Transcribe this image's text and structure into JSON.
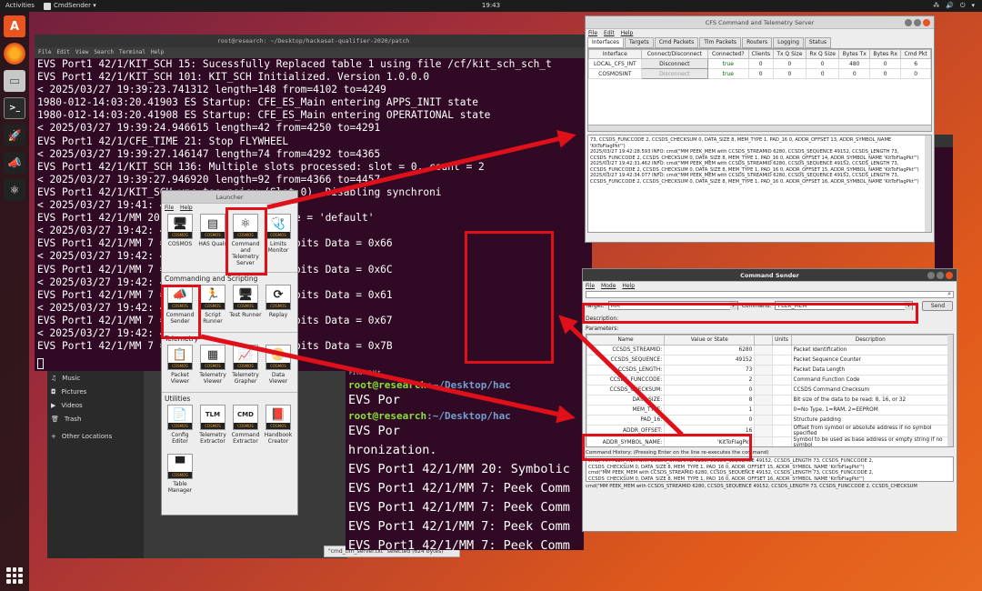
{
  "topbar": {
    "activities": "Activities",
    "app": "CmdSender ▾",
    "clock": "19:43",
    "tray": [
      "⁂",
      "🔊",
      "⏻",
      "▾"
    ]
  },
  "dock": {
    "icons": [
      "software-icon",
      "firefox-icon",
      "files-icon",
      "terminal-icon",
      "cosmos-rocket-icon",
      "cmd-sender-icon",
      "cts-icon"
    ]
  },
  "terminal1": {
    "title": "root@research: ~/Desktop/hackasat-qualifier-2020/patch",
    "menu": [
      "File",
      "Edit",
      "View",
      "Search",
      "Terminal",
      "Help"
    ],
    "lines": [
      "EVS Port1 42/1/KIT_SCH 15: Sucessfully Replaced table 1 using file /cf/kit_sch_sch_t",
      "EVS Port1 42/1/KIT_SCH 101: KIT_SCH Initialized. Version 1.0.0.0",
      "< 2025/03/27 19:39:23.741312  length=148 from=4102 to=4249",
      "1980-012-14:03:20.41903 ES Startup: CFE_ES_Main entering APPS_INIT state",
      "1980-012-14:03:20.41908 ES Startup: CFE_ES_Main entering OPERATIONAL state",
      "< 2025/03/27 19:39:24.946615  length=42 from=4250 to=4291",
      "EVS Port1 42/1/CFE_TIME 21: Stop FLYWHEEL",
      "< 2025/03/27 19:39:27.146147  length=74 from=4292 to=4365",
      "EVS Port1 42/1/KIT_SCH 136: Multiple slots processed: slot = 0, count = 2",
      "< 2025/03/27 19:39:27.946920  length=92 from=4366 to=4457",
      "EVS Port1 42/1/KIT_SCH                               ync too noisy (Slot 0). Disabling synchroni",
      "< 2025/03/27 19:41:                        4458 to=4532",
      "EVS Port1 42/1/MM 20                       an't be resolved: Name = 'default'",
      "< 2025/03/27 19:42:                        4533 to=4611",
      "EVS Port1 42/1/MM 7                        = 0xF4436C8C Size = 8 bits Data = 0x66",
      "< 2025/03/27 19:42:                        4612 to=4690",
      "EVS Port1 42/1/MM 7                        = 0xF4436C8D Size = 8 bits Data = 0x6C",
      "< 2025/03/27 19:42:                        4691 to=4769",
      "EVS Port1 42/1/MM 7                        = 0xF4436C8E Size = 8 bits Data = 0x61",
      "< 2025/03/27 19:42:                        4770 to=4848",
      "EVS Port1 42/1/MM 7                        = 0xF4436C8F Size = 8 bits Data = 0x67",
      "< 2025/03/27 19:42:                        4849 to=4927",
      "EVS Port1 42/1/MM 7                        = 0xF4436C90 Size = 8 bits Data = 0x7B"
    ]
  },
  "terminal2": {
    "menu": [
      "File",
      "Edit"
    ],
    "prompt_user": "root@research",
    "prompt_path": ":~/Desktop/hac",
    "lines": [
      "EVS Por",
      "EVS Por",
      "hronization.",
      "EVS Port1 42/1/MM 20: Symbolic",
      "EVS Port1 42/1/MM 7: Peek Comm",
      "EVS Port1 42/1/MM 7: Peek Comm",
      "EVS Port1 42/1/MM 7: Peek Comm",
      "EVS Port1 42/1/MM 7: Peek Comm",
      "EVS Port1 42/1/MM 7: Peek Comm"
    ]
  },
  "files": {
    "places": [
      {
        "icon": "music-icon",
        "label": "Music"
      },
      {
        "icon": "pictures-icon",
        "label": "Pictures"
      },
      {
        "icon": "videos-icon",
        "label": "Videos"
      },
      {
        "icon": "trash-icon",
        "label": "Trash"
      },
      {
        "icon": "plus-icon",
        "label": "Other Locations"
      }
    ],
    "status": "\"cmd_tlm_server.txt\" selected  (624 bytes)"
  },
  "launcher": {
    "title": "Launcher",
    "menu": [
      "File",
      "Help"
    ],
    "top": [
      {
        "label": "COSMOS"
      },
      {
        "label": "HAS Quals"
      },
      {
        "label": "Command and Telemetry Server"
      },
      {
        "label": "Limits Monitor"
      }
    ],
    "section_cs": "Commanding and Scripting",
    "cs": [
      {
        "label": "Command Sender"
      },
      {
        "label": "Script Runner"
      },
      {
        "label": "Test Runner"
      },
      {
        "label": "Replay"
      }
    ],
    "section_tlm": "Telemetry",
    "tlm": [
      {
        "label": "Packet Viewer"
      },
      {
        "label": "Telemetry Viewer"
      },
      {
        "label": "Telemetry Grapher"
      },
      {
        "label": "Data Viewer"
      }
    ],
    "section_util": "Utilities",
    "util": [
      {
        "label": "Config Editor"
      },
      {
        "label": "Telemetry Extractor"
      },
      {
        "label": "Command Extractor"
      },
      {
        "label": "Handbook Creator"
      }
    ],
    "util2": [
      {
        "label": "Table Manager"
      }
    ]
  },
  "cts": {
    "title": "CFS Command and Telemetry Server",
    "menu": [
      "File",
      "Edit",
      "Help"
    ],
    "tabs": [
      "Interfaces",
      "Targets",
      "Cmd Packets",
      "Tlm Packets",
      "Routers",
      "Logging",
      "Status"
    ],
    "headers": [
      "Interface",
      "Connect/Disconnect",
      "Connected?",
      "Clients",
      "Tx Q Size",
      "Rx Q Size",
      "Bytes Tx",
      "Bytes Rx",
      "Cmd Pkt"
    ],
    "rows": [
      [
        "LOCAL_CFS_INT",
        "Disconnect",
        "true",
        "0",
        "0",
        "0",
        "480",
        "0",
        "6"
      ],
      [
        "COSMOSINT",
        "Disconnect",
        "true",
        "0",
        "0",
        "0",
        "0",
        "0",
        "0"
      ]
    ],
    "log": [
      "73, CCSDS_FUNCCODE 2, CCSDS_CHECKSUM 0, DATA_SIZE 8, MEM_TYPE 1, PAD_16 0, ADDR_OFFSET 13, ADDR_SYMBOL_NAME 'KitToFlagPkt'\")",
      "2025/03/27 19:42:28.593  INFO: cmd(\"MM PEEK_MEM with CCSDS_STREAMID 6280, CCSDS_SEQUENCE 49152, CCSDS_LENGTH 73, CCSDS_FUNCCODE 2, CCSDS_CHECKSUM 0, DATA_SIZE 8, MEM_TYPE 1, PAD_16 0, ADDR_OFFSET 14, ADDR_SYMBOL_NAME 'KitToFlagPkt'\")",
      "2025/03/27 19:42:31.462  INFO: cmd(\"MM PEEK_MEM with CCSDS_STREAMID 6280, CCSDS_SEQUENCE 49152, CCSDS_LENGTH 73, CCSDS_FUNCCODE 2, CCSDS_CHECKSUM 0, DATA_SIZE 8, MEM_TYPE 1, PAD_16 0, ADDR_OFFSET 15, ADDR_SYMBOL_NAME 'KitToFlagPkt'\")",
      "2025/03/27 19:42:34.077  INFO: cmd(\"MM PEEK_MEM with CCSDS_STREAMID 6280, CCSDS_SEQUENCE 49152, CCSDS_LENGTH 73, CCSDS_FUNCCODE 2, CCSDS_CHECKSUM 0, DATA_SIZE 8, MEM_TYPE 1, PAD_16 0, ADDR_OFFSET 16, ADDR_SYMBOL_NAME 'KitToFlagPkt'\")"
    ]
  },
  "sender": {
    "title": "Command Sender",
    "menu": [
      "File",
      "Mode",
      "Help"
    ],
    "target_label": "Target:",
    "target_value": "MM",
    "command_label": "Command:",
    "command_value": "PEEK_MEM",
    "send": "Send",
    "description_label": "Description:",
    "parameters_label": "Parameters:",
    "headers": [
      "Name",
      "Value or State",
      "",
      "Units",
      "Description"
    ],
    "params": [
      [
        "CCSDS_STREAMID:",
        "6280",
        "",
        "Packet Identification"
      ],
      [
        "CCSDS_SEQUENCE:",
        "49152",
        "",
        "Packet Sequence Counter"
      ],
      [
        "CCSDS_LENGTH:",
        "73",
        "",
        "Packet Data Length"
      ],
      [
        "CCSDS_FUNCCODE:",
        "2",
        "",
        "Command Function Code"
      ],
      [
        "CCSDS_CHECKSUM:",
        "0",
        "",
        "CCSDS Command Checksum"
      ],
      [
        "DATA_SIZE:",
        "8",
        "",
        "Bit size of the data to be read: 8, 16, or 32"
      ],
      [
        "MEM_TYPE:",
        "1",
        "",
        "0=No Type, 1=RAM, 2=EEPROM"
      ],
      [
        "PAD_16:",
        "0",
        "",
        "Structure padding"
      ],
      [
        "ADDR_OFFSET:",
        "16",
        "",
        "Offset from symbol or absolute address if no symbol specified"
      ],
      [
        "ADDR_SYMBOL_NAME:",
        "'KitToFlagPkt'",
        "",
        "Symbol to be used as base address or empty string if no symbol"
      ]
    ],
    "history_label": "Command History: (Pressing Enter on the line re-executes the command)",
    "history": [
      "cmd(\"MM PEEK_MEM with CCSDS_STREAMID 6280, CCSDS_SEQUENCE 49152, CCSDS_LENGTH 73, CCSDS_FUNCCODE 2,",
      "CCSDS_CHECKSUM 0, DATA_SIZE 8, MEM_TYPE 1, PAD_16 0, ADDR_OFFSET 15, ADDR_SYMBOL_NAME 'KitToFlagPkt'\")",
      "cmd(\"MM PEEK_MEM with CCSDS_STREAMID 6280, CCSDS_SEQUENCE 49152, CCSDS_LENGTH 73, CCSDS_FUNCCODE 2,",
      "CCSDS_CHECKSUM 0, DATA_SIZE 8, MEM_TYPE 1, PAD_16 0, ADDR_OFFSET 16, ADDR_SYMBOL_NAME 'KitToFlagPkt'\")"
    ],
    "status_line": "cmd(\"MM PEEK_MEM with CCSDS_STREAMID 6280, CCSDS_SEQUENCE 49152, CCSDS_LENGTH 73, CCSDS_FUNCCODE 2, CCSDS_CHECKSUM"
  },
  "colors": {
    "accent": "#e95420",
    "annotation": "#e0101a",
    "terminal_bg": "#300a24"
  }
}
